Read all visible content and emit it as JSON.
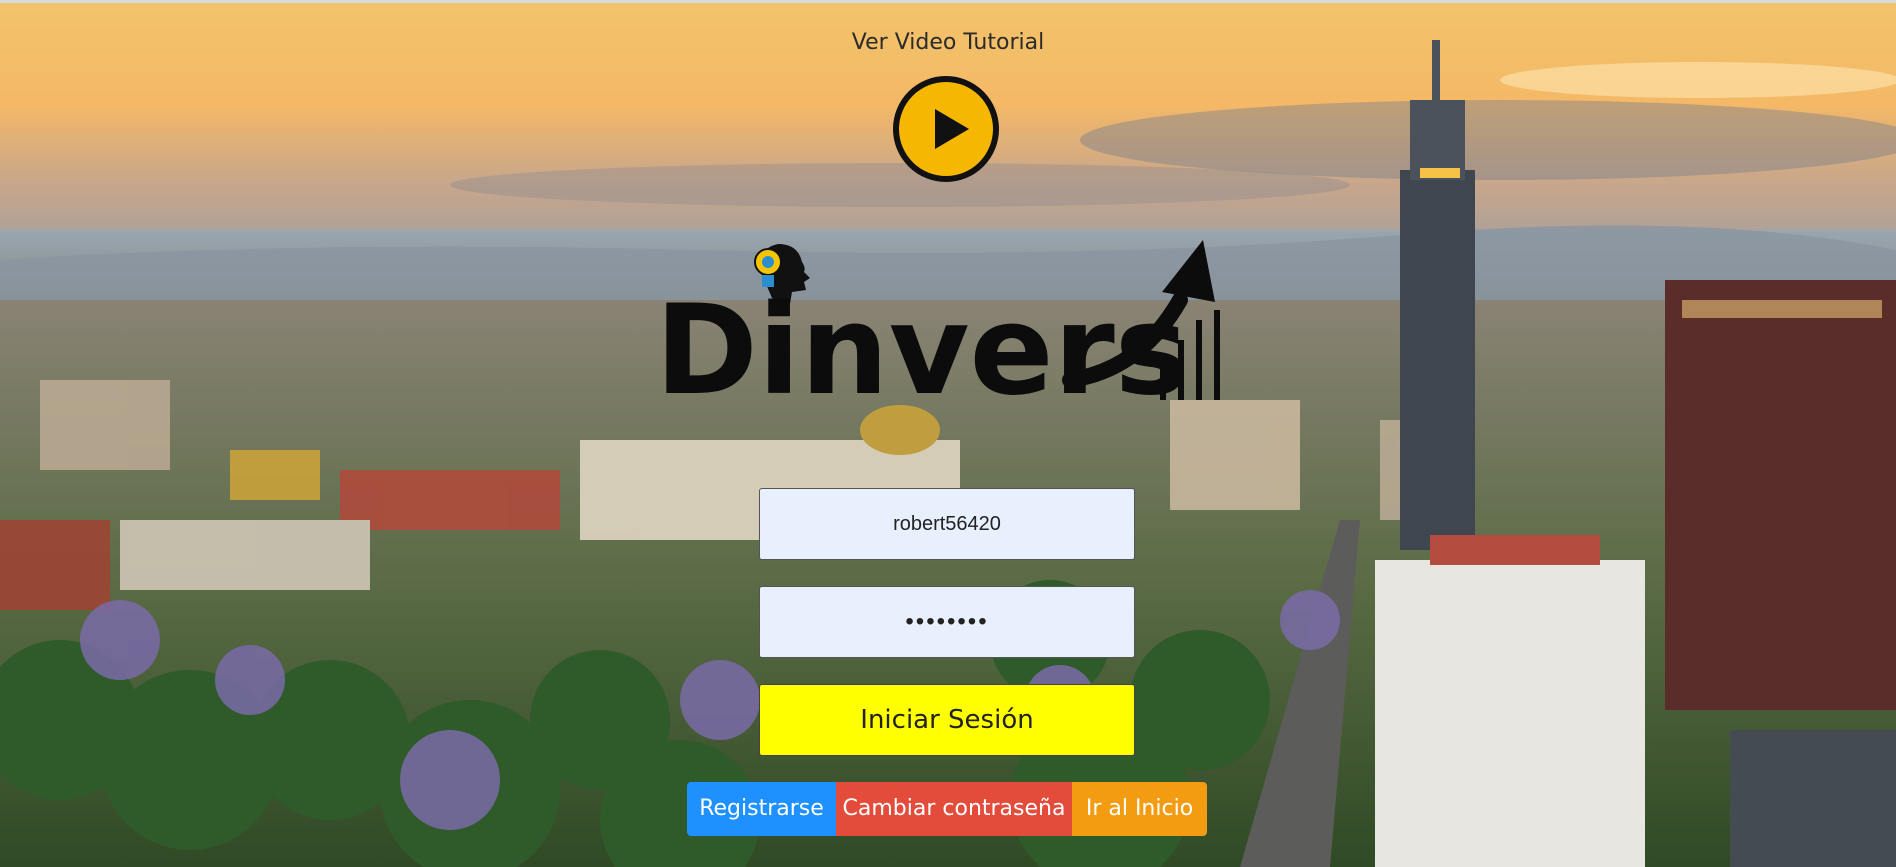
{
  "tutorial": {
    "label": "Ver Video Tutorial"
  },
  "logo": {
    "text": "Dinvers"
  },
  "login": {
    "username_value": "robert56420",
    "password_value": "robert12",
    "submit_label": "Iniciar Sesión"
  },
  "links": {
    "register": "Registrarse",
    "change_password": "Cambiar contraseña",
    "home": "Ir al Inicio"
  },
  "colors": {
    "play_button": "#f5b701",
    "submit": "#ffff00",
    "register": "#1e90ff",
    "change_password": "#e34b3b",
    "home": "#f39c12"
  }
}
